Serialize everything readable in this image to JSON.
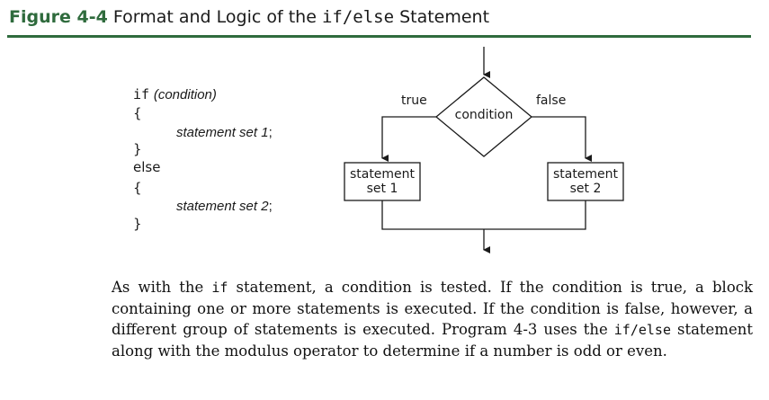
{
  "figure": {
    "label": "Figure 4-4",
    "title_pre": "Format and Logic of the",
    "title_code": "if/else",
    "title_post": "Statement"
  },
  "code": {
    "if_kw": "if",
    "condition": "(condition)",
    "open1": "{",
    "stmt1": "statement set 1",
    "semi1": ";",
    "close1": "}",
    "else_kw": "else",
    "open2": "{",
    "stmt2": "statement set 2",
    "semi2": ";",
    "close2": "}"
  },
  "flowchart": {
    "decision": "condition",
    "true_label": "true",
    "false_label": "false",
    "left_box_line1": "statement",
    "left_box_line2": "set 1",
    "right_box_line1": "statement",
    "right_box_line2": "set 2"
  },
  "paragraph": {
    "p1": "As with the ",
    "c1": "if",
    "p2": " statement, a condition is tested. If the condition is true, a block containing one or more statements is executed. If the condition is false, however, a different group of statements is executed. Program 4-3 uses the ",
    "c2": "if/else",
    "p3": " statement along with the modulus operator to determine if a number is odd or even."
  }
}
